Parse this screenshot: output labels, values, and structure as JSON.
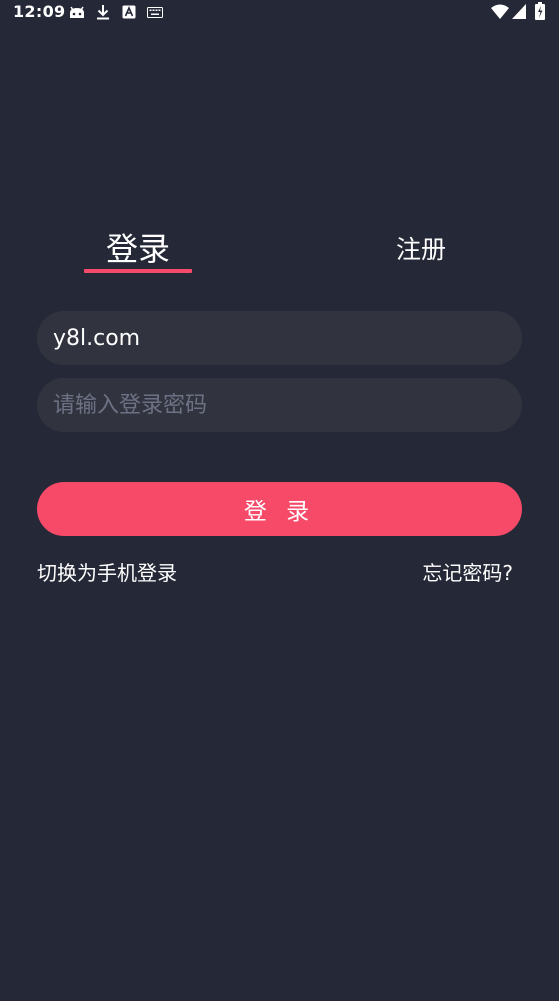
{
  "status_bar": {
    "time": "12:09",
    "icons": [
      "android-debug-icon",
      "download-icon",
      "font-a-icon",
      "keyboard-icon",
      "wifi-icon",
      "cellular-signal-icon",
      "battery-icon"
    ]
  },
  "tabs": [
    {
      "label": "登录",
      "active": true
    },
    {
      "label": "注册",
      "active": false
    }
  ],
  "form": {
    "account_value": "y8l.com",
    "password_placeholder": "请输入登录密码",
    "password_value": ""
  },
  "login_button": {
    "label": "登 录"
  },
  "links": {
    "switch_phone": "切换为手机登录",
    "forgot_password": "忘记密码?"
  },
  "colors": {
    "background": "#252937",
    "input_background": "#31343f",
    "accent": "#f64a68",
    "placeholder": "#6c7184",
    "text": "#ffffff"
  }
}
